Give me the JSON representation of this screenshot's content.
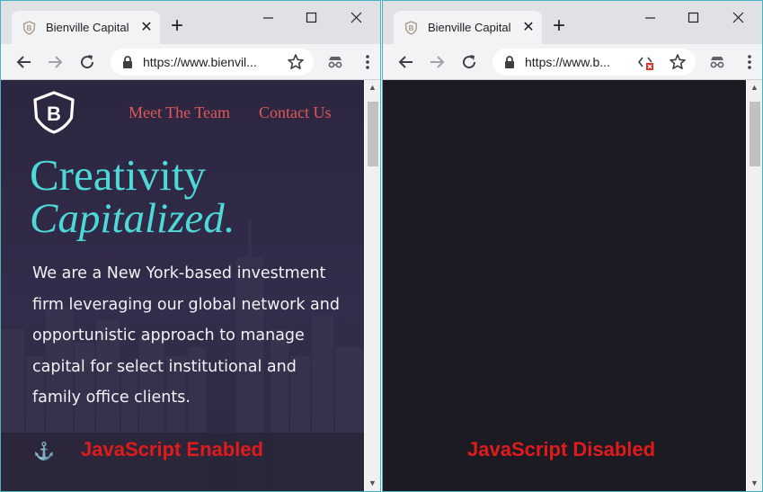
{
  "left_window": {
    "tab": {
      "title": "Bienville Capital",
      "favicon": "bienville-shield-icon",
      "close": "✕"
    },
    "new_tab": "+",
    "url": "https://www.bienvil...",
    "nav": {
      "meet_team": "Meet The Team",
      "contact_us": "Contact Us"
    },
    "hero": {
      "line1": "Creativity",
      "line2": "Capitalized."
    },
    "body_text": "We are a New York-based investment firm leveraging our global network and opportunistic approach to manage capital for select institutional and family office clients.",
    "anchor_icon": "⚓",
    "logo_letter": "B",
    "caption": "JavaScript Enabled"
  },
  "right_window": {
    "tab": {
      "title": "Bienville Capital",
      "favicon": "bienville-shield-icon",
      "close": "✕"
    },
    "new_tab": "+",
    "url": "https://www.b...",
    "caption": "JavaScript Disabled"
  },
  "scrollbar": {
    "up": "▲",
    "down": "▼"
  },
  "colors": {
    "site_background": "#2e2a42",
    "heading_teal": "#4fd8d8",
    "nav_coral": "#e0565a",
    "caption_red": "#e01b1b",
    "blank_page": "#1c1b24",
    "window_border": "#46b3c3"
  }
}
